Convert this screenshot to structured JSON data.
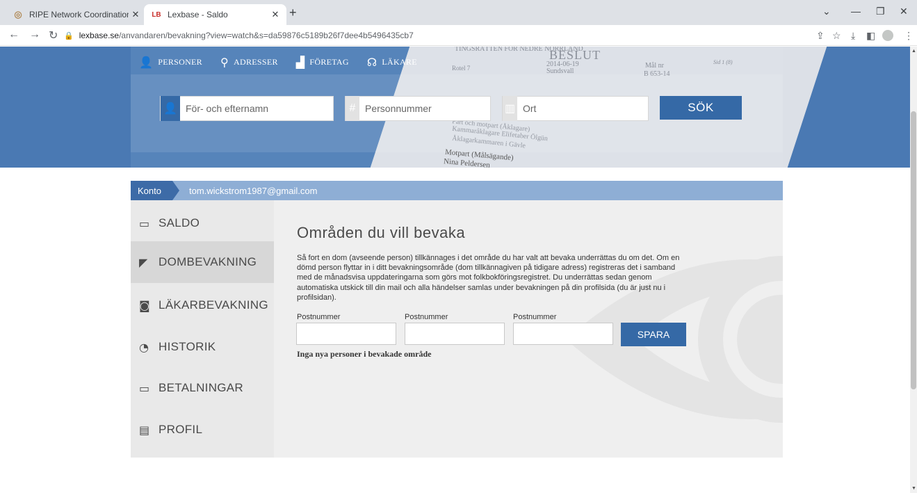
{
  "browser": {
    "tabs": [
      {
        "title": "RIPE Network Coordination Cent",
        "favicon": "ripe-favicon"
      },
      {
        "title": "Lexbase - Saldo",
        "favicon": "LB"
      }
    ],
    "url_host": "lexbase.se",
    "url_path": "/anvandaren/bevakning?view=watch&s=da59876c5189b26f7dee4b5496435cb7"
  },
  "topnav": {
    "items": [
      {
        "label": "PERSONER",
        "icon": "person-icon"
      },
      {
        "label": "ADRESSER",
        "icon": "map-pin-icon"
      },
      {
        "label": "FÖRETAG",
        "icon": "factory-icon"
      },
      {
        "label": "LÄKARE",
        "icon": "stethoscope-icon"
      }
    ]
  },
  "search": {
    "name_placeholder": "För- och efternamn",
    "pnr_placeholder": "Personnummer",
    "ort_placeholder": "Ort",
    "button": "SÖK"
  },
  "document_bg": {
    "heading": "BESLUT",
    "court": "TINGSRÄTTEN FÖR NEDRE NORRLAND",
    "date": "2014-06-19",
    "place": "Sundsvall",
    "mal": "Mål nr",
    "mal_nr": "B 653-14",
    "sid": "Sid 1 (8)",
    "rotel": "Rotel 7",
    "party_line1": "Part och motpart (Åklagare)",
    "party_line2": "Kammaråklagare Elifetaber Ölgün",
    "party_line3": "Åklagarkammaren i Gävle",
    "motpart": "Motpart (Målsägande)",
    "motpart_name": "Nina Peldersen"
  },
  "breadcrumb": {
    "section": "Konto",
    "email": "tom.wickstrom1987@gmail.com"
  },
  "sidebar": {
    "items": [
      {
        "label": "SALDO",
        "icon": "card-icon"
      },
      {
        "label": "DOMBEVAKNING",
        "icon": "camera-icon"
      },
      {
        "label": "LÄKARBEVAKNING",
        "icon": "camera-lock-icon"
      },
      {
        "label": "HISTORIK",
        "icon": "history-icon"
      },
      {
        "label": "BETALNINGAR",
        "icon": "card-icon"
      },
      {
        "label": "PROFIL",
        "icon": "id-card-icon"
      }
    ],
    "active_index": 1
  },
  "main": {
    "title": "Områden du vill bevaka",
    "description": "Så fort en dom (avseende person) tillkännages i det område du har valt att bevaka underrättas du om det. Om en dömd person flyttar in i ditt bevakningsområde (dom tillkännagiven på tidigare adress) registreras det i samband med de månadsvisa uppdateringarna som görs mot folkbokföringsregistret. Du underrättas sedan genom automatiska utskick till din mail och alla händelser samlas under bevakningen på din profilsida (du är just nu i profilsidan).",
    "postal_label": "Postnummer",
    "postal_values": [
      "",
      "",
      ""
    ],
    "save_button": "SPARA",
    "status": "Inga nya personer i bevakade område"
  }
}
